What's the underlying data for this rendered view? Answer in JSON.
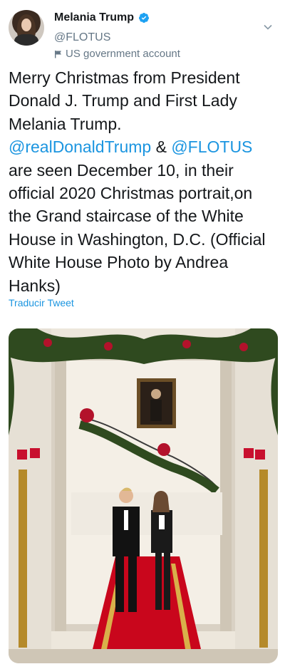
{
  "header": {
    "name": "Melania Trump",
    "handle": "@FLOTUS",
    "account_label": "US government account",
    "verified_color": "#1da1f2"
  },
  "tweet": {
    "line1": "Merry Christmas from President Donald J. Trump and First Lady Melania Trump.",
    "mention1": "@realDonaldTrump",
    "amp": " & ",
    "mention2": "@FLOTUS",
    "line2": "are seen December 10, in their official 2020 Christmas portrait,on the Grand staircase of the White House in Washington, D.C. (Official White House Photo by Andrea Hanks)"
  },
  "translate_label": "Traducir Tweet",
  "colors": {
    "link": "#1b95e0",
    "muted": "#657786",
    "text": "#14171a"
  },
  "icons": [
    "verified-badge-icon",
    "flag-icon",
    "chevron-down-icon"
  ]
}
